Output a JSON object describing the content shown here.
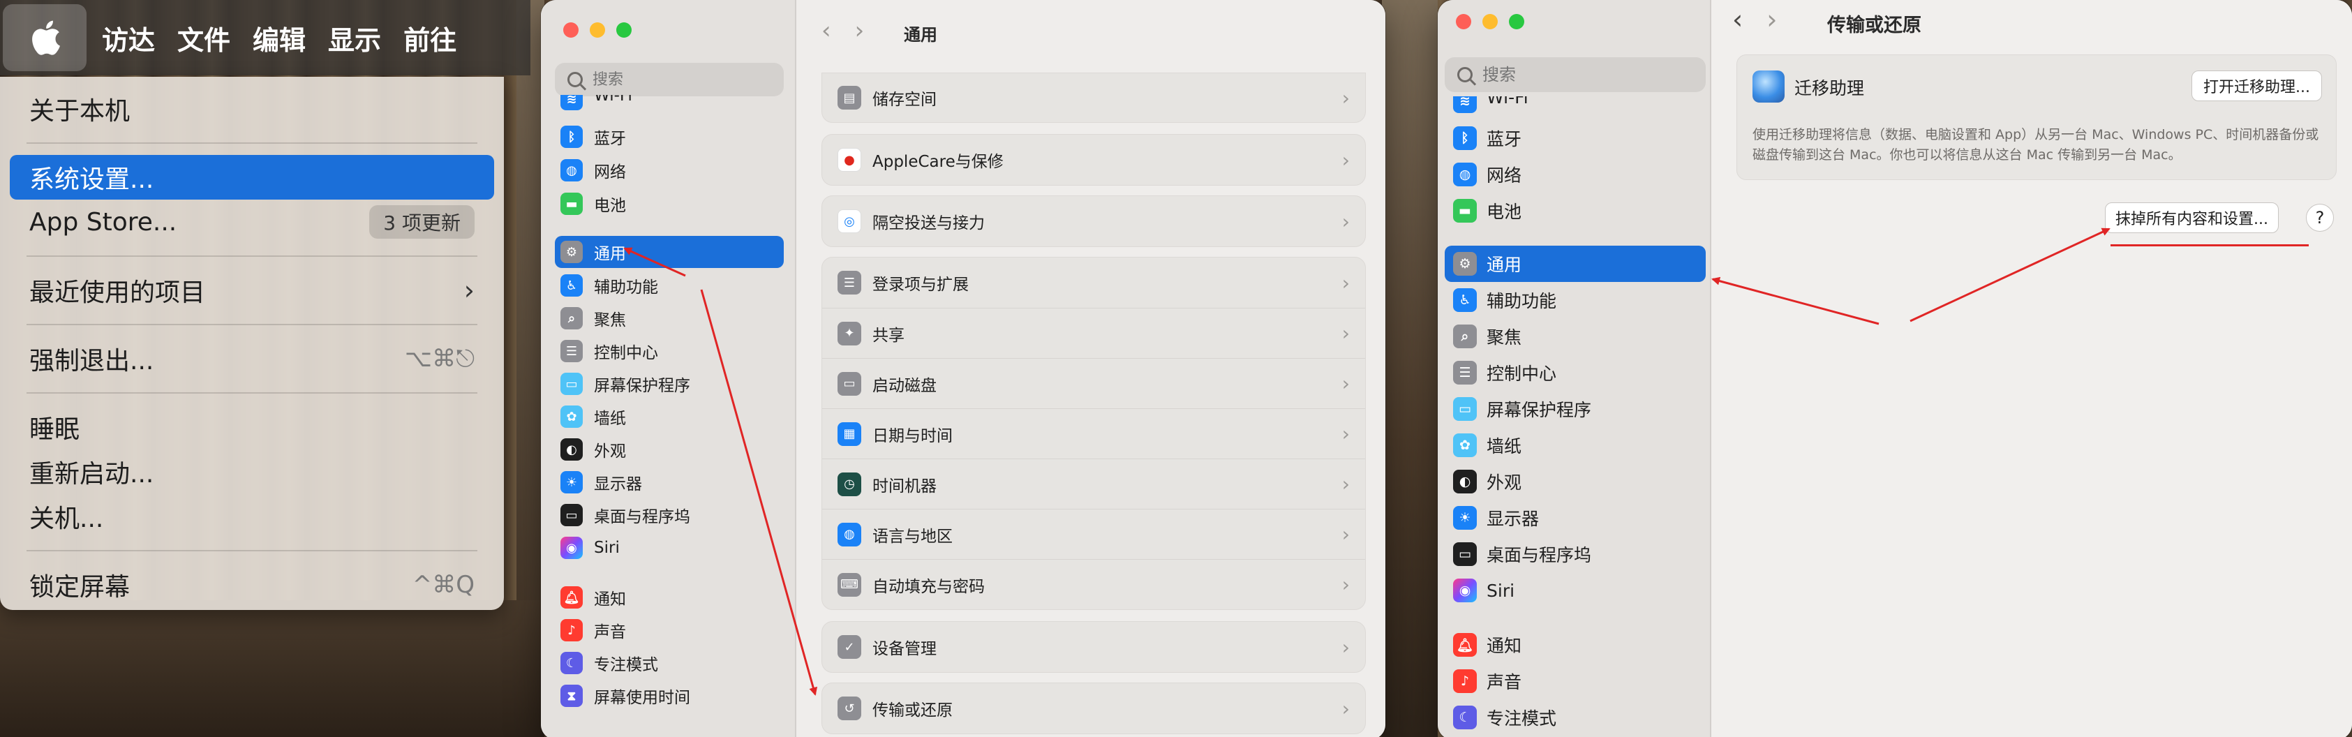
{
  "menubar": {
    "items": [
      "访达",
      "文件",
      "编辑",
      "显示",
      "前往"
    ]
  },
  "apple_menu": {
    "about": "关于本机",
    "system_settings": "系统设置...",
    "app_store": "App Store...",
    "app_store_badge": "3 项更新",
    "recent_items": "最近使用的项目",
    "force_quit": "强制退出...",
    "force_quit_shortcut": "⌥⌘⎋",
    "sleep": "睡眠",
    "restart": "重新启动...",
    "shutdown": "关机...",
    "lock_screen": "锁定屏幕",
    "lock_screen_shortcut": "^⌘Q"
  },
  "general_window": {
    "title": "通用",
    "search_placeholder": "搜索",
    "sidebar": {
      "wifi_partial": "Wi-Fi",
      "bluetooth": "蓝牙",
      "network": "网络",
      "battery": "电池",
      "general": "通用",
      "accessibility": "辅助功能",
      "spotlight": "聚焦",
      "control_center": "控制中心",
      "screen_saver": "屏幕保护程序",
      "wallpaper": "墙纸",
      "appearance": "外观",
      "displays": "显示器",
      "desktop_dock": "桌面与程序坞",
      "siri": "Siri",
      "notifications": "通知",
      "sound": "声音",
      "focus": "专注模式",
      "screen_time": "屏幕使用时间"
    },
    "rows": {
      "storage": "储存空间",
      "applecare": "AppleCare与保修",
      "airdrop": "隔空投送与接力",
      "login_items": "登录项与扩展",
      "sharing": "共享",
      "startup_disk": "启动磁盘",
      "date_time": "日期与时间",
      "time_machine": "时间机器",
      "language_region": "语言与地区",
      "autofill": "自动填充与密码",
      "device_management": "设备管理",
      "transfer_reset": "传输或还原"
    }
  },
  "transfer_window": {
    "title": "传输或还原",
    "search_placeholder": "搜索",
    "sidebar": {
      "wifi_partial": "Wi-Fi",
      "bluetooth": "蓝牙",
      "network": "网络",
      "battery": "电池",
      "general": "通用",
      "accessibility": "辅助功能",
      "spotlight": "聚焦",
      "control_center": "控制中心",
      "screen_saver": "屏幕保护程序",
      "wallpaper": "墙纸",
      "appearance": "外观",
      "displays": "显示器",
      "desktop_dock": "桌面与程序坞",
      "siri": "Siri",
      "notifications": "通知",
      "sound": "声音",
      "focus": "专注模式"
    },
    "migration_title": "迁移助理",
    "migration_button": "打开迁移助理...",
    "migration_desc": "使用迁移助理将信息（数据、电脑设置和 App）从另一台 Mac、Windows PC、时间机器备份或磁盘传输到这台 Mac。你也可以将信息从这台 Mac 传输到另一台 Mac。",
    "erase_button": "抹掉所有内容和设置...",
    "help_button": "?"
  },
  "colors": {
    "accent": "#1b6fd9",
    "annotation": "#e02525"
  }
}
